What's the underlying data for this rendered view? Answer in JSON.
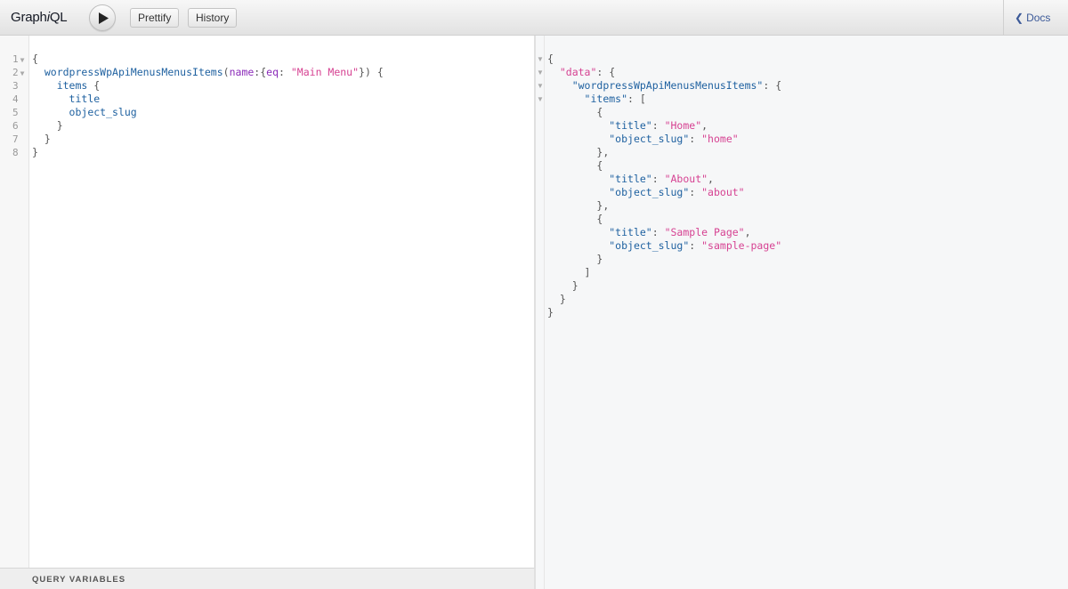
{
  "app": {
    "title_prefix": "Graph",
    "title_italic": "i",
    "title_suffix": "QL"
  },
  "toolbar": {
    "prettify_label": "Prettify",
    "history_label": "History",
    "docs_label": "Docs"
  },
  "editor": {
    "line_numbers": [
      "1",
      "2",
      "3",
      "4",
      "5",
      "6",
      "7",
      "8"
    ],
    "query": {
      "root_field": "wordpressWpApiMenusMenusItems",
      "arg_name": "name",
      "arg_op": "eq",
      "arg_value": "\"Main Menu\"",
      "sub_field": "items",
      "fields": [
        "title",
        "object_slug"
      ]
    }
  },
  "query_variables_label": "QUERY VARIABLES",
  "result": {
    "data_key": "\"data\"",
    "root_key": "\"wordpressWpApiMenusMenusItems\"",
    "items_key": "\"items\"",
    "title_key": "\"title\"",
    "slug_key": "\"object_slug\"",
    "items": [
      {
        "title": "\"Home\"",
        "slug": "\"home\""
      },
      {
        "title": "\"About\"",
        "slug": "\"about\""
      },
      {
        "title": "\"Sample Page\"",
        "slug": "\"sample-page\""
      }
    ]
  },
  "colors": {
    "field": "#1F61A0",
    "argument": "#8B2BB9",
    "string": "#D64292",
    "docs_link": "#3B5998"
  }
}
